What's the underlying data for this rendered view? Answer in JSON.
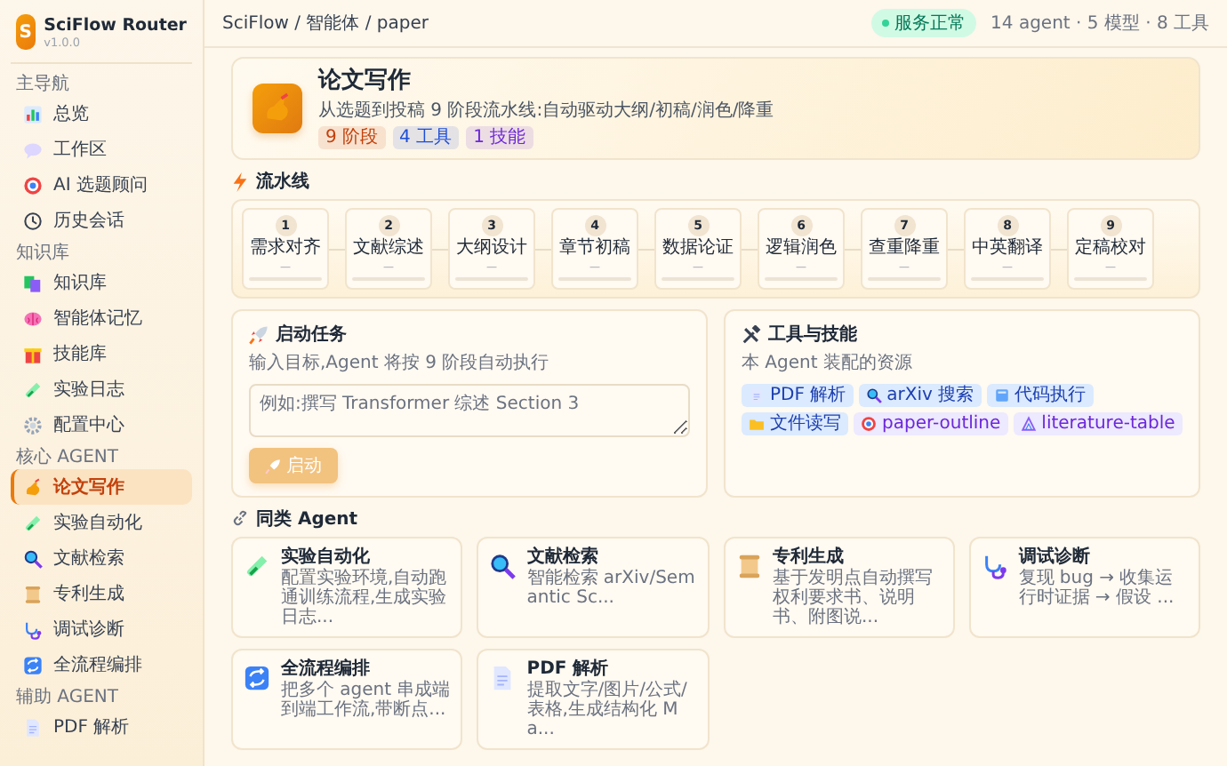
{
  "app": {
    "logo": "S",
    "name": "SciFlow Router",
    "version": "v1.0.0"
  },
  "sidebar": {
    "sections": [
      {
        "title": "主导航",
        "items": [
          {
            "label": "总览",
            "selected": false
          },
          {
            "label": "工作区",
            "selected": false
          },
          {
            "label": "AI 选题顾问",
            "selected": false
          },
          {
            "label": "历史会话",
            "selected": false
          }
        ]
      },
      {
        "title": "知识库",
        "items": [
          {
            "label": "知识库",
            "selected": false
          },
          {
            "label": "智能体记忆",
            "selected": false
          },
          {
            "label": "技能库",
            "selected": false
          },
          {
            "label": "实验日志",
            "selected": false
          },
          {
            "label": "配置中心",
            "selected": false
          }
        ]
      },
      {
        "title": "核心 AGENT",
        "items": [
          {
            "label": "论文写作",
            "selected": true
          },
          {
            "label": "实验自动化",
            "selected": false
          },
          {
            "label": "文献检索",
            "selected": false
          },
          {
            "label": "专利生成",
            "selected": false
          },
          {
            "label": "调试诊断",
            "selected": false
          },
          {
            "label": "全流程编排",
            "selected": false
          }
        ]
      },
      {
        "title": "辅助 AGENT",
        "items": [
          {
            "label": "PDF 解析",
            "selected": false
          }
        ]
      }
    ]
  },
  "topbar": {
    "breadcrumb": "SciFlow / 智能体 / paper",
    "status": "服务正常",
    "summary": "14 agent · 5 模型 · 8 工具"
  },
  "hero": {
    "title": "论文写作",
    "subtitle": "从选题到投稿 9 阶段流水线:自动驱动大纲/初稿/润色/降重",
    "tags": [
      {
        "label": "9 阶段",
        "color": "#c2410c"
      },
      {
        "label": "4 工具",
        "color": "#1d4ed8"
      },
      {
        "label": "1 技能",
        "color": "#6d28d9"
      }
    ]
  },
  "pipeline": {
    "title": "流水线",
    "steps": [
      {
        "number": "1",
        "label": "需求对齐",
        "status": "—"
      },
      {
        "number": "2",
        "label": "文献综述",
        "status": "—"
      },
      {
        "number": "3",
        "label": "大纲设计",
        "status": "—"
      },
      {
        "number": "4",
        "label": "章节初稿",
        "status": "—"
      },
      {
        "number": "5",
        "label": "数据论证",
        "status": "—"
      },
      {
        "number": "6",
        "label": "逻辑润色",
        "status": "—"
      },
      {
        "number": "7",
        "label": "查重降重",
        "status": "—"
      },
      {
        "number": "8",
        "label": "中英翻译",
        "status": "—"
      },
      {
        "number": "9",
        "label": "定稿校对",
        "status": "—"
      }
    ]
  },
  "launch": {
    "title": "启动任务",
    "subtitle": "输入目标,Agent 将按 9 阶段自动执行",
    "placeholder": "例如:撰写 Transformer 综述 Section 3",
    "button": "启动",
    "disabled": true
  },
  "tools": {
    "title": "工具与技能",
    "subtitle": "本 Agent 装配的资源",
    "items": [
      {
        "label": "PDF 解析",
        "kind": "tool"
      },
      {
        "label": "arXiv 搜索",
        "kind": "tool"
      },
      {
        "label": "代码执行",
        "kind": "tool"
      },
      {
        "label": "文件读写",
        "kind": "tool"
      },
      {
        "label": "paper-outline",
        "kind": "skill"
      },
      {
        "label": "literature-table",
        "kind": "skill"
      }
    ]
  },
  "related": {
    "title": "同类 Agent",
    "agents": [
      {
        "name": "实验自动化",
        "description": "配置实验环境,自动跑通训练流程,生成实验日志..."
      },
      {
        "name": "文献检索",
        "description": "智能检索 arXiv/Semantic Sc..."
      },
      {
        "name": "专利生成",
        "description": "基于发明点自动撰写权利要求书、说明书、附图说..."
      },
      {
        "name": "调试诊断",
        "description": "复现 bug → 收集运行时证据 → 假设 ..."
      },
      {
        "name": "全流程编排",
        "description": "把多个 agent 串成端到端工作流,带断点..."
      },
      {
        "name": "PDF 解析",
        "description": "提取文字/图片/公式/表格,生成结构化 Ma..."
      }
    ]
  }
}
